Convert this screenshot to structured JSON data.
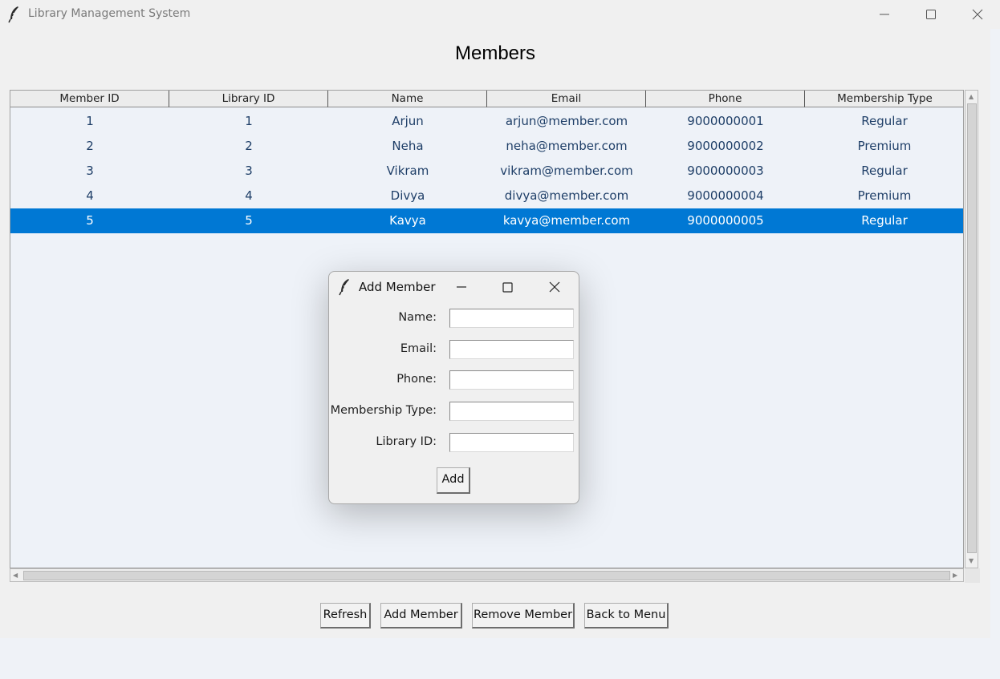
{
  "window": {
    "title": "Library Management System"
  },
  "page": {
    "heading": "Members"
  },
  "table": {
    "columns": [
      "Member ID",
      "Library ID",
      "Name",
      "Email",
      "Phone",
      "Membership Type"
    ],
    "rows": [
      [
        "1",
        "1",
        "Arjun",
        "arjun@member.com",
        "9000000001",
        "Regular"
      ],
      [
        "2",
        "2",
        "Neha",
        "neha@member.com",
        "9000000002",
        "Premium"
      ],
      [
        "3",
        "3",
        "Vikram",
        "vikram@member.com",
        "9000000003",
        "Regular"
      ],
      [
        "4",
        "4",
        "Divya",
        "divya@member.com",
        "9000000004",
        "Premium"
      ],
      [
        "5",
        "5",
        "Kavya",
        "kavya@member.com",
        "9000000005",
        "Regular"
      ]
    ],
    "selected_row_index": 4
  },
  "buttons": {
    "refresh": "Refresh",
    "add_member": "Add Member",
    "remove_member": "Remove Member",
    "back_to_menu": "Back to Menu"
  },
  "dialog": {
    "title": "Add Member",
    "fields": {
      "name": {
        "label": "Name:",
        "value": ""
      },
      "email": {
        "label": "Email:",
        "value": ""
      },
      "phone": {
        "label": "Phone:",
        "value": ""
      },
      "membership_type": {
        "label": "Membership Type:",
        "value": ""
      },
      "library_id": {
        "label": "Library ID:",
        "value": ""
      }
    },
    "add_label": "Add"
  },
  "colors": {
    "selection": "#0078d4",
    "cell_text": "#1f3f68",
    "tree_background": "#eef2f8"
  },
  "icons": {
    "app": "feather-icon",
    "minimize": "minimize-icon",
    "maximize": "maximize-icon",
    "close": "close-icon"
  }
}
